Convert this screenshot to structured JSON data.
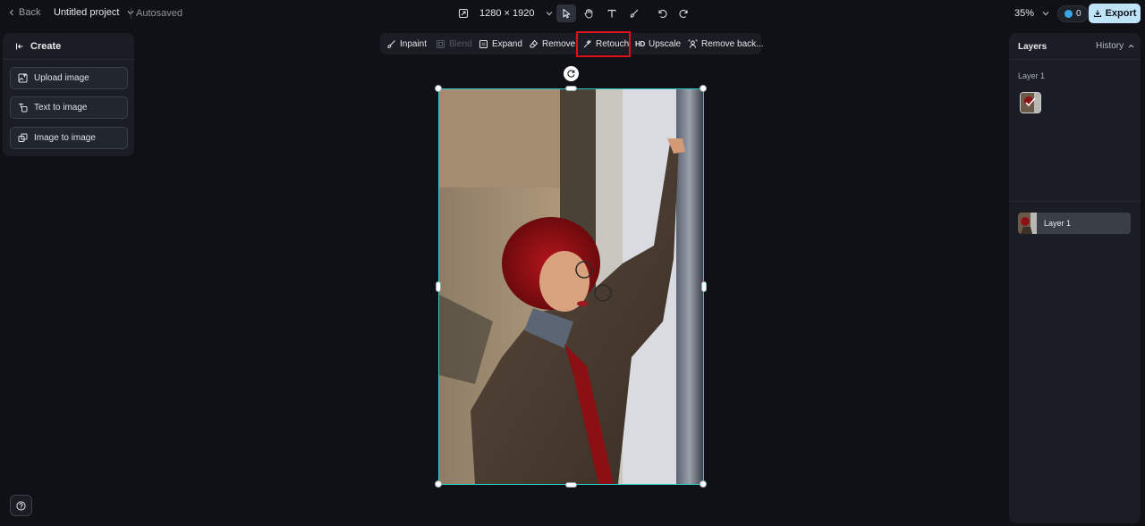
{
  "topbar": {
    "back_label": "Back",
    "project_name": "Untitled project",
    "status": "Autosaved",
    "canvas_size": "1280 × 1920",
    "zoom": "35%",
    "credits": "0",
    "export_label": "Export"
  },
  "tools": [
    "select-tool",
    "hand-tool",
    "text-tool",
    "brush-tool",
    "undo",
    "redo"
  ],
  "left_panel": {
    "title": "Create",
    "buttons": [
      {
        "label": "Upload image",
        "icon": "upload-image-icon"
      },
      {
        "label": "Text to image",
        "icon": "text-to-image-icon"
      },
      {
        "label": "Image to image",
        "icon": "image-to-image-icon"
      }
    ]
  },
  "edit_toolbar": {
    "inpaint": "Inpaint",
    "blend": "Blend",
    "expand": "Expand",
    "remove": "Remove",
    "retouch": "Retouch",
    "upscale_badge": "HD",
    "upscale": "Upscale",
    "remove_bg": "Remove back..."
  },
  "highlight_color": "#e0101c",
  "selection_color": "#2bc7c2",
  "right_panel": {
    "title": "Layers",
    "history": "History",
    "group_label": "Layer 1",
    "layers": [
      {
        "label": "Layer 1"
      }
    ]
  }
}
